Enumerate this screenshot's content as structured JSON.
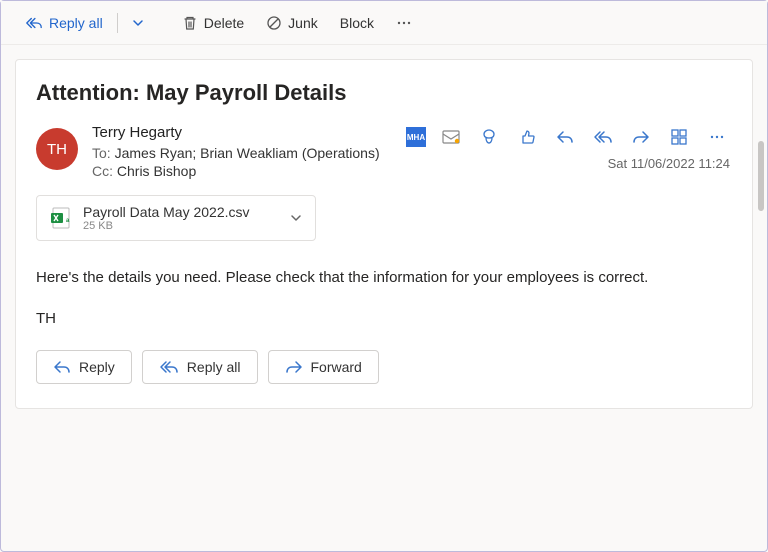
{
  "toolbar": {
    "reply_all": "Reply all",
    "delete": "Delete",
    "junk": "Junk",
    "block": "Block"
  },
  "email": {
    "subject": "Attention: May Payroll Details",
    "sender_initials": "TH",
    "sender_name": "Terry Hegarty",
    "to_label": "To:",
    "to_names": "James Ryan;  Brian Weakliam (Operations)",
    "cc_label": "Cc:",
    "cc_names": "Chris Bishop",
    "timestamp": "Sat 11/06/2022 11:24",
    "badge": "MHA"
  },
  "attachment": {
    "name": "Payroll Data May 2022.csv",
    "size": "25 KB"
  },
  "body": {
    "line1": "Here's the details you need. Please check that the information for your employees is correct.",
    "line2": "TH"
  },
  "actions": {
    "reply": "Reply",
    "reply_all": "Reply all",
    "forward": "Forward"
  }
}
